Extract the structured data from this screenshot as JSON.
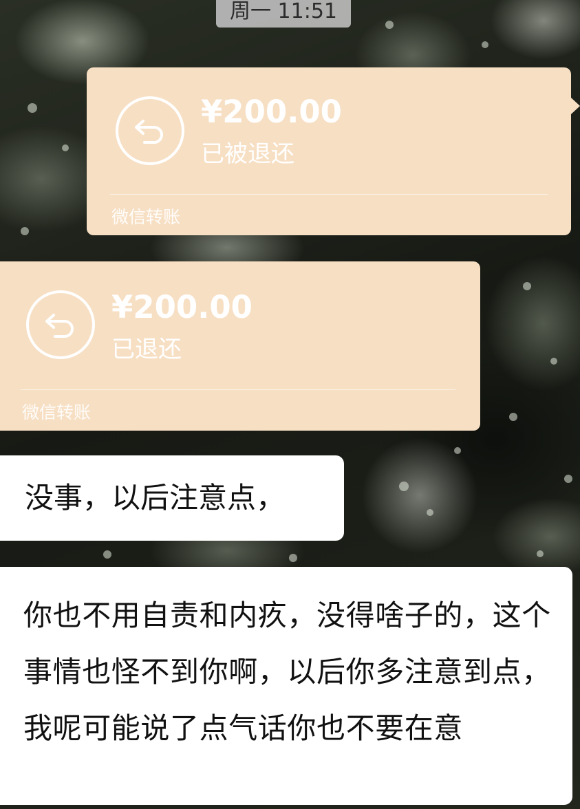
{
  "timestamp": "周一 11:51",
  "transfers": [
    {
      "amount": "¥200.00",
      "status": "已被退还",
      "footer": "微信转账",
      "icon": "return-arrow-icon",
      "side": "right"
    },
    {
      "amount": "¥200.00",
      "status": "已退还",
      "footer": "微信转账",
      "icon": "return-arrow-icon",
      "side": "left"
    }
  ],
  "messages": [
    {
      "side": "left",
      "text": "没事，以后注意点，"
    },
    {
      "side": "left",
      "text": "你也不用自责和内疚，没得啥子的，这个事情也怪不到你啊，以后你多注意到点，我呢可能说了点气话你也不要在意"
    }
  ],
  "colors": {
    "transfer_card": "#f7dfc4",
    "bubble": "#ffffff",
    "text": "#111111",
    "time_pill": "#c8c8c8"
  }
}
